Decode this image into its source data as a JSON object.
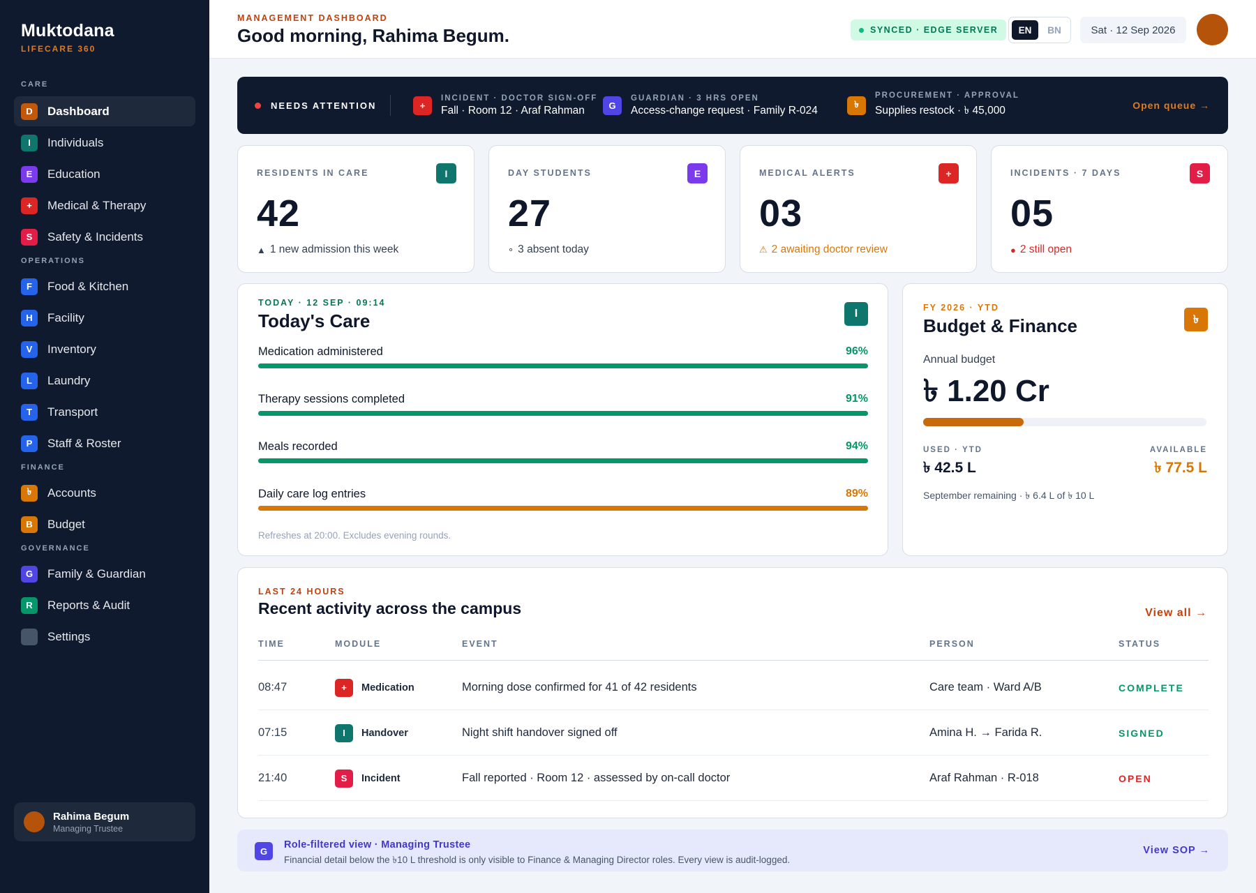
{
  "brand": {
    "name": "Muktodana",
    "sub": "LIFECARE 360"
  },
  "nav": [
    {
      "section": "CARE",
      "items": [
        {
          "badge": "D",
          "label": "Dashboard",
          "color": "#c2580c",
          "active": true
        },
        {
          "badge": "I",
          "label": "Individuals",
          "color": "#0f766e"
        },
        {
          "badge": "E",
          "label": "Education",
          "color": "#7c3aed"
        },
        {
          "badge": "+",
          "label": "Medical & Therapy",
          "color": "#dc2626"
        },
        {
          "badge": "S",
          "label": "Safety & Incidents",
          "color": "#e11d48"
        }
      ]
    },
    {
      "section": "OPERATIONS",
      "items": [
        {
          "badge": "F",
          "label": "Food & Kitchen",
          "color": "#2563eb"
        },
        {
          "badge": "H",
          "label": "Facility",
          "color": "#2563eb"
        },
        {
          "badge": "V",
          "label": "Inventory",
          "color": "#2563eb"
        },
        {
          "badge": "L",
          "label": "Laundry",
          "color": "#2563eb"
        },
        {
          "badge": "T",
          "label": "Transport",
          "color": "#2563eb"
        },
        {
          "badge": "P",
          "label": "Staff & Roster",
          "color": "#2563eb"
        }
      ]
    },
    {
      "section": "FINANCE",
      "items": [
        {
          "badge": "৳",
          "label": "Accounts",
          "color": "#d97706"
        },
        {
          "badge": "B",
          "label": "Budget",
          "color": "#d97706"
        }
      ]
    },
    {
      "section": "GOVERNANCE",
      "items": [
        {
          "badge": "G",
          "label": "Family & Guardian",
          "color": "#4f46e5"
        },
        {
          "badge": "R",
          "label": "Reports & Audit",
          "color": "#059669"
        },
        {
          "badge": "",
          "label": "Settings",
          "color": "#475569"
        }
      ]
    }
  ],
  "user": {
    "name": "Rahima Begum",
    "role": "Managing Trustee"
  },
  "header": {
    "eyebrow": "MANAGEMENT DASHBOARD",
    "title": "Good morning, Rahima Begum.",
    "sync": "SYNCED · EDGE SERVER",
    "lang_en": "EN",
    "lang_bn": "BN",
    "date": "Sat · 12 Sep 2026"
  },
  "attention": {
    "label": "NEEDS ATTENTION",
    "items": [
      {
        "badge": "+",
        "color": "#dc2626",
        "kicker": "INCIDENT · DOCTOR SIGN-OFF",
        "text": "Fall · Room 12 · Araf Rahman"
      },
      {
        "badge": "G",
        "color": "#4f46e5",
        "kicker": "GUARDIAN · 3 HRS OPEN",
        "text": "Access-change request · Family R-024"
      },
      {
        "badge": "৳",
        "color": "#d97706",
        "kicker": "PROCUREMENT · APPROVAL",
        "text": "Supplies restock · ৳ 45,000"
      }
    ],
    "open": "Open queue →"
  },
  "stats": [
    {
      "label": "RESIDENTS IN CARE",
      "value": "42",
      "badge": "I",
      "color": "#0f766e",
      "marker": "▲",
      "note": "1 new admission this week",
      "note_color": "#334155"
    },
    {
      "label": "DAY STUDENTS",
      "value": "27",
      "badge": "E",
      "color": "#7c3aed",
      "marker": "∘",
      "note": "3 absent today",
      "note_color": "#334155"
    },
    {
      "label": "MEDICAL ALERTS",
      "value": "03",
      "badge": "+",
      "color": "#dc2626",
      "marker": "⚠",
      "note": "2 awaiting doctor review",
      "note_color": "#d97706"
    },
    {
      "label": "INCIDENTS · 7 DAYS",
      "value": "05",
      "badge": "S",
      "color": "#e11d48",
      "marker": "●",
      "note": "2 still open",
      "note_color": "#dc2626"
    }
  ],
  "care": {
    "eyebrow": "TODAY · 12 SEP · 09:14",
    "title": "Today's Care",
    "badge": "I",
    "rows": [
      {
        "label": "Medication administered",
        "pct": "96%",
        "fill": 1.0,
        "color": "#059669"
      },
      {
        "label": "Therapy sessions completed",
        "pct": "91%",
        "fill": 1.0,
        "color": "#059669"
      },
      {
        "label": "Meals recorded",
        "pct": "94%",
        "fill": 1.0,
        "color": "#059669"
      },
      {
        "label": "Daily care log entries",
        "pct": "89%",
        "fill": 1.0,
        "color": "#d97706"
      }
    ],
    "foot": "Refreshes at 20:00. Excludes evening rounds."
  },
  "finance": {
    "eyebrow": "FY 2026 · YTD",
    "title": "Budget & Finance",
    "badge": "৳",
    "annual_label": "Annual budget",
    "annual_value": "৳ 1.20 Cr",
    "used_fraction": 0.354,
    "used_label": "USED · YTD",
    "used_value": "৳ 42.5 L",
    "avail_label": "AVAILABLE",
    "avail_value": "৳ 77.5 L",
    "remaining": "September remaining · ৳ 6.4 L of ৳ 10 L"
  },
  "activity": {
    "eyebrow": "LAST 24 HOURS",
    "title": "Recent activity across the campus",
    "view_all": "View all →",
    "columns": [
      "TIME",
      "MODULE",
      "EVENT",
      "PERSON",
      "STATUS"
    ],
    "rows": [
      {
        "time": "08:47",
        "badge": "+",
        "badge_color": "#dc2626",
        "module": "Medication",
        "event": "Morning dose confirmed for 41 of 42 residents",
        "person": "Care team · Ward A/B",
        "status": "COMPLETE",
        "status_color": "#059669"
      },
      {
        "time": "07:15",
        "badge": "I",
        "badge_color": "#0f766e",
        "module": "Handover",
        "event": "Night shift handover signed off",
        "person": "Amina H. → Farida R.",
        "status": "SIGNED",
        "status_color": "#059669"
      },
      {
        "time": "21:40",
        "badge": "S",
        "badge_color": "#e11d48",
        "module": "Incident",
        "event": "Fall reported · Room 12 · assessed by on-call doctor",
        "person": "Araf Rahman · R-018",
        "status": "OPEN",
        "status_color": "#dc2626"
      }
    ]
  },
  "banner": {
    "badge": "G",
    "title": "Role-filtered view · Managing Trustee",
    "text": "Financial detail below the ৳10 L threshold is only visible to Finance & Managing Director roles. Every view is audit-logged.",
    "link": "View SOP →"
  }
}
